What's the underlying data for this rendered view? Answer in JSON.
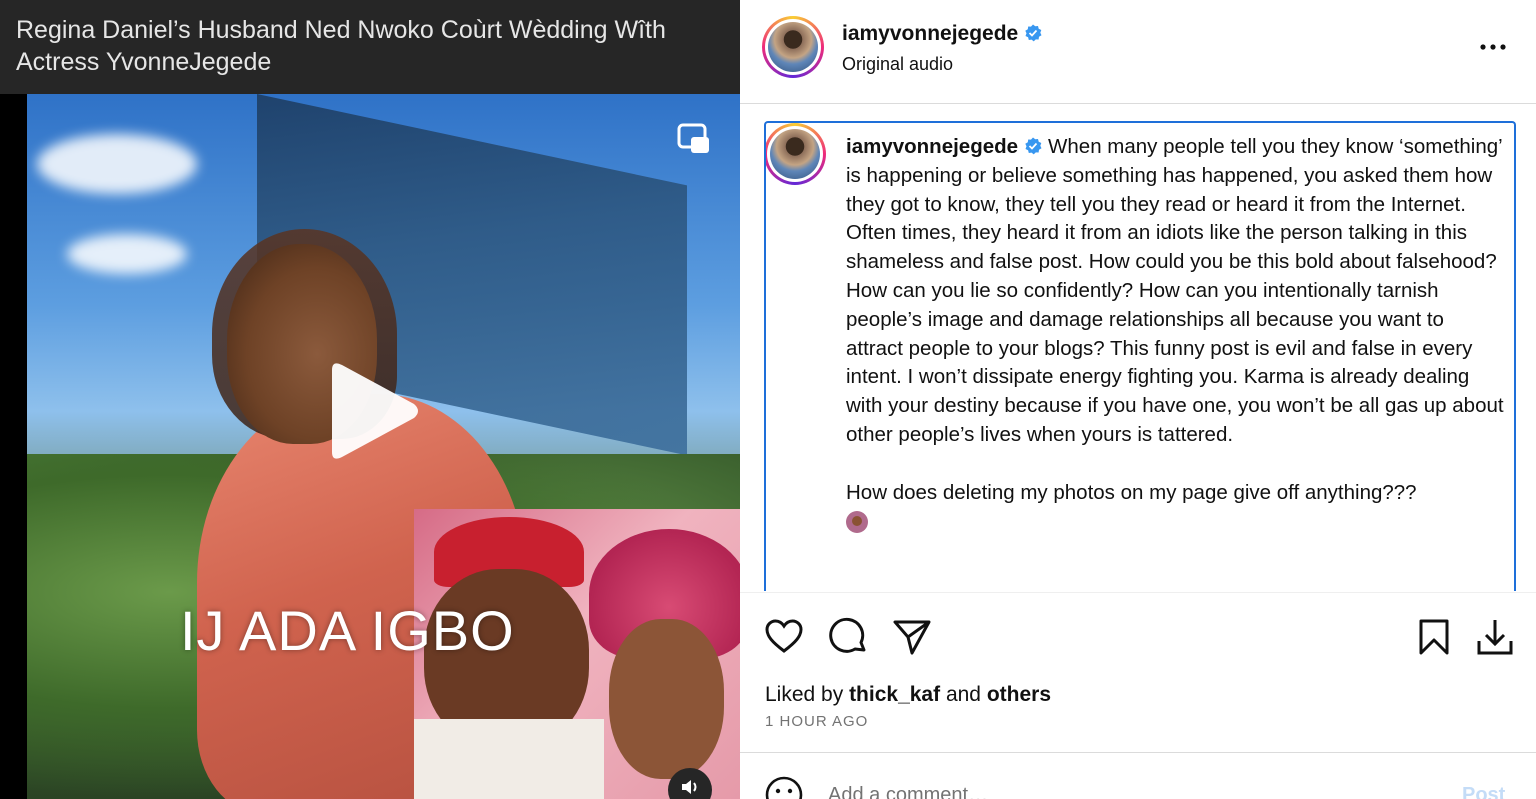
{
  "video": {
    "title": "Regina Daniel’s Husband Ned Nwoko Coùrt Wèdding Wîth Actress YvonneJegede",
    "overlay_text": "IJ ADA IGBO",
    "icons": [
      "picture-in-picture-icon",
      "play-icon",
      "volume-icon"
    ]
  },
  "post": {
    "header": {
      "username": "iamyvonnejegede",
      "subtitle": "Original audio",
      "verified": true
    },
    "caption": {
      "username": "iamyvonnejegede",
      "text": "When many people tell you they know ‘something’ is happening or believe something has happened, you asked them how they got to know, they tell you they read or heard it from the Internet. Often times, they heard it from an idiots like the person talking in this shameless and false post. How could you be this bold about falsehood? How can you lie so confidently? How can you intentionally tarnish people’s image and damage relationships all because you want to attract people to your blogs? This funny post is evil and false in every intent. I won’t dissipate energy fighting you. Karma is already dealing with your destiny because if you have one, you won’t be all gas up about other people’s lives when yours is tattered.",
      "text2": "How does deleting my photos on my page give off anything???"
    },
    "likes": {
      "prefix": "Liked by",
      "user": "thick_kaf",
      "and": "and",
      "others": "others"
    },
    "time": "1 HOUR AGO",
    "comment": {
      "placeholder": "Add a comment…",
      "post_label": "Post"
    },
    "colors": {
      "accent": "#1e6fd9",
      "verified": "#3897f0",
      "post_disabled": "#c4dcf7"
    }
  }
}
